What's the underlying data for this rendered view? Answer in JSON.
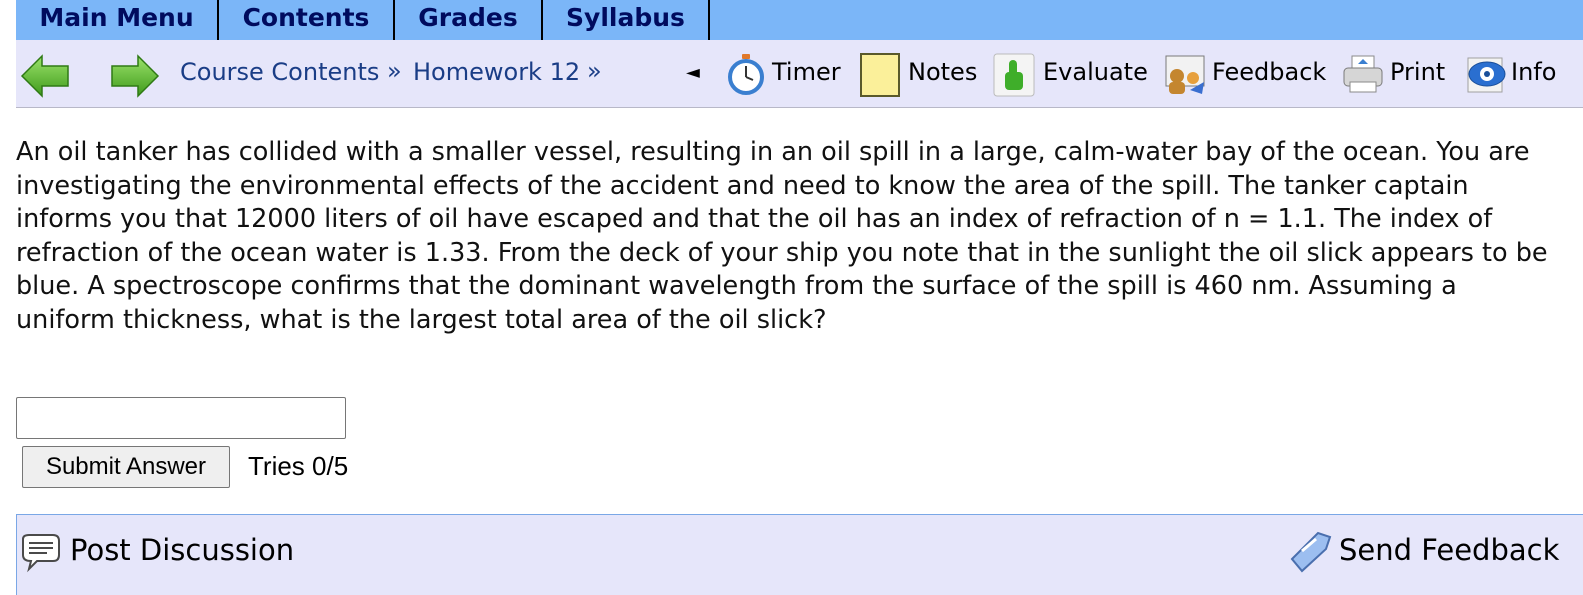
{
  "menu": {
    "tabs": [
      {
        "label": "Main Menu"
      },
      {
        "label": "Contents"
      },
      {
        "label": "Grades"
      },
      {
        "label": "Syllabus"
      }
    ],
    "accent_color": "#7bb6f8",
    "text_color": "#000b5e"
  },
  "toolbar": {
    "breadcrumb": [
      {
        "label": "Course Contents"
      },
      {
        "label": "Homework 12"
      }
    ],
    "separator": "»",
    "collapse_glyph": "◄",
    "tools": [
      {
        "label": "Timer",
        "icon": "stopwatch-icon"
      },
      {
        "label": "Notes",
        "icon": "note-icon"
      },
      {
        "label": "Evaluate",
        "icon": "thumbs-up-icon"
      },
      {
        "label": "Feedback",
        "icon": "feedback-icon"
      },
      {
        "label": "Print",
        "icon": "printer-icon"
      },
      {
        "label": "Info",
        "icon": "info-icon"
      }
    ],
    "background": "#e6e6fa"
  },
  "problem": {
    "text": "An oil tanker has collided with a smaller vessel, resulting in an oil spill in a large, calm-water bay of the ocean. You are investigating the environmental effects of the accident and need to know the area of the spill. The tanker captain informs you that 12000 liters of oil have escaped and that the oil has an index of refraction of n = 1.1. The index of refraction of the ocean water is 1.33. From the deck of your ship you note that in the sunlight the oil slick appears to be blue. A spectroscope confirms that the dominant wavelength from the surface of the spill is 460 nm. Assuming a uniform thickness, what is the largest total area of the oil slick?"
  },
  "answer": {
    "value": "",
    "submit_label": "Submit Answer",
    "tries": "Tries 0/5"
  },
  "footer": {
    "post_discussion": "Post Discussion",
    "send_feedback": "Send Feedback"
  }
}
